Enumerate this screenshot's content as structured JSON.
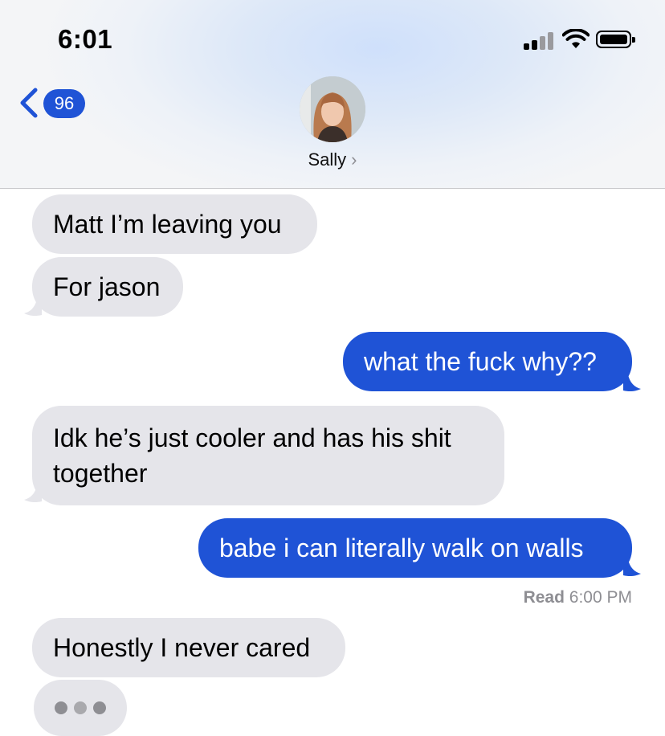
{
  "status_bar": {
    "time": "6:01"
  },
  "nav": {
    "unread_count": "96",
    "contact_name": "Sally",
    "chevron": "›"
  },
  "messages": [
    {
      "from": "them",
      "text": "Matt I’m leaving you"
    },
    {
      "from": "them",
      "text": "For jason"
    },
    {
      "from": "me",
      "text": "what the fuck why??"
    },
    {
      "from": "them",
      "text": "Idk he’s just cooler and has his shit together"
    },
    {
      "from": "me",
      "text": "babe i can literally walk on walls"
    },
    {
      "from": "them",
      "text": "Honestly I never cared"
    }
  ],
  "read_receipt": {
    "label": "Read",
    "time": "6:00 PM"
  },
  "colors": {
    "outgoing": "#1f53d6",
    "incoming": "#e5e5ea",
    "badge": "#1f53d6"
  },
  "icons": [
    "signal-icon",
    "wifi-icon",
    "battery-icon",
    "back-chevron-icon",
    "typing-indicator"
  ]
}
